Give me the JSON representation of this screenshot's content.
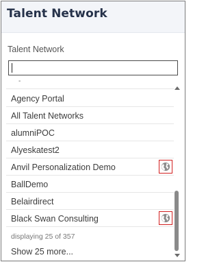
{
  "header": {
    "title": "Talent Network"
  },
  "field": {
    "label": "Talent Network",
    "search_value": "",
    "search_placeholder": ""
  },
  "list": {
    "partial_item": "-",
    "items": [
      {
        "label": "Agency Portal",
        "icon": null
      },
      {
        "label": "All Talent Networks",
        "icon": null
      },
      {
        "label": "alumniPOC",
        "icon": null
      },
      {
        "label": "Alyeskatest2",
        "icon": null
      },
      {
        "label": "Anvil Personalization Demo",
        "icon": "globe-icon"
      },
      {
        "label": "BallDemo",
        "icon": null
      },
      {
        "label": "Belairdirect",
        "icon": null
      },
      {
        "label": "Black Swan Consulting",
        "icon": "globe-icon"
      }
    ],
    "count_text": "displaying 25 of 357",
    "show_more_label": "Show 25 more..."
  },
  "colors": {
    "header_bg": "#f3f5f9",
    "title_text": "#26324a",
    "badge_border": "#d21f1f"
  }
}
